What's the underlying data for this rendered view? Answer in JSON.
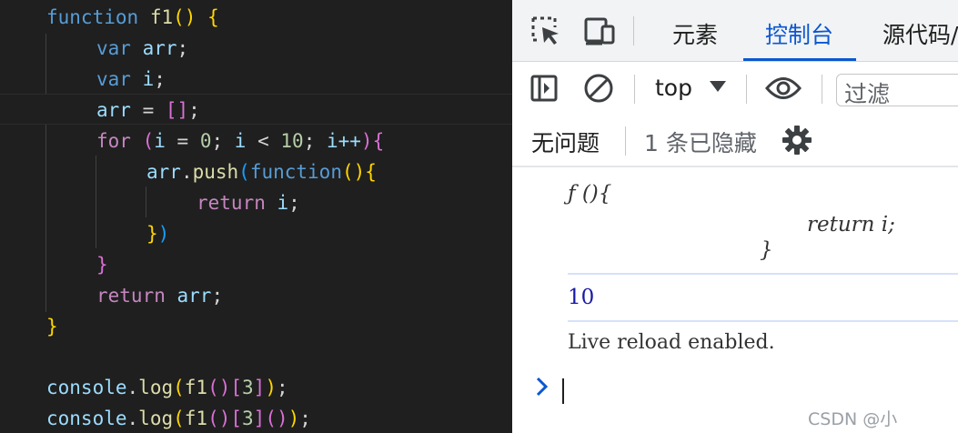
{
  "editor": {
    "code": {
      "l1": {
        "kw": "function",
        "name": "f1",
        "paren": "()",
        "brace": "{"
      },
      "l2": {
        "kw": "var",
        "name": "arr",
        "semi": ";"
      },
      "l3": {
        "kw": "var",
        "name": "i",
        "semi": ";"
      },
      "l4": {
        "name": "arr",
        "op": " = ",
        "arr": "[]",
        "semi": ";"
      },
      "l5": {
        "kw": "for",
        "open": "(",
        "a": "i",
        "eq": " = ",
        "zero": "0",
        "s1": "; ",
        "b": "i",
        "lt": " < ",
        "ten": "10",
        "s2": "; ",
        "c": "i++",
        "close": ")",
        "brace": "{"
      },
      "l6": {
        "obj": "arr",
        "dot": ".",
        "method": "push",
        "open": "(",
        "fkw": "function",
        "fparen": "()",
        "brace": "{"
      },
      "l7": {
        "kw": "return",
        "name": "i",
        "semi": ";"
      },
      "l8": {
        "brace": "}",
        "close": ")"
      },
      "l9": {
        "brace": "}"
      },
      "l10": {
        "kw": "return",
        "name": "arr",
        "semi": ";"
      },
      "l11": {
        "brace": "}"
      },
      "l13": {
        "obj": "console",
        "dot": ".",
        "method": "log",
        "open": "(",
        "fn": "f1",
        "fparen": "()",
        "br": "[",
        "idx": "3",
        "brc": "]",
        "close": ")",
        "semi": ";"
      },
      "l14": {
        "obj": "console",
        "dot": ".",
        "method": "log",
        "open": "(",
        "fn": "f1",
        "fparen": "()",
        "br": "[",
        "idx": "3",
        "brc": "]",
        "call": "()",
        "close": ")",
        "semi": ";"
      }
    }
  },
  "devtools": {
    "tabs": {
      "elements": "元素",
      "console": "控制台",
      "sources": "源代码/"
    },
    "toolbar": {
      "context": "top",
      "filter_placeholder": "过滤"
    },
    "issues": {
      "no_issues": "无问题",
      "hidden": "1 条已隐藏"
    },
    "console": {
      "fn_head": "ƒ (){",
      "fn_body": "return i;",
      "fn_tail": "}",
      "value": "10",
      "live": "Live reload enabled."
    },
    "watermark": "CSDN @小"
  },
  "colors": {
    "accent": "#0b57d0",
    "editor_bg": "#1f1f1f"
  }
}
